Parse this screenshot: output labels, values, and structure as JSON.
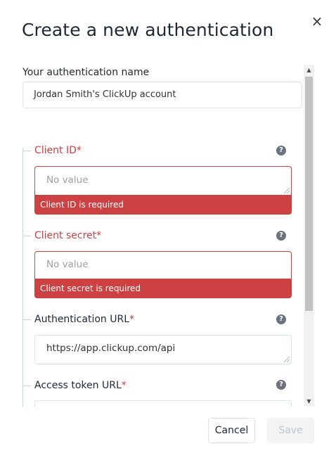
{
  "modal": {
    "title": "Create a new authentication",
    "close_glyph": "×"
  },
  "name_field": {
    "label": "Your authentication name",
    "value": "Jordan Smith's ClickUp account"
  },
  "fields": {
    "client_id": {
      "label": "Client ID",
      "required_mark": "*",
      "placeholder": "No value",
      "error": "Client ID is required"
    },
    "client_secret": {
      "label": "Client secret",
      "required_mark": "*",
      "placeholder": "No value",
      "error": "Client secret is required"
    },
    "auth_url": {
      "label": "Authentication URL",
      "required_mark": "*",
      "value": "https://app.clickup.com/api"
    },
    "token_url": {
      "label": "Access token URL",
      "required_mark": "*"
    }
  },
  "help_glyph": "?",
  "scrollbar": {
    "up_glyph": "▲",
    "down_glyph": "▼"
  },
  "footer": {
    "cancel_label": "Cancel",
    "save_label": "Save"
  },
  "colors": {
    "error": "#cd4143",
    "border": "#dfe3e8",
    "text": "#1f2933",
    "placeholder": "#9aa1a9",
    "help_icon": "#6b7280",
    "disabled_bg": "#f1f3f5"
  },
  "icons": [
    "close-icon",
    "help-icon",
    "resize-grip-icon",
    "scroll-up-icon",
    "scroll-down-icon"
  ]
}
